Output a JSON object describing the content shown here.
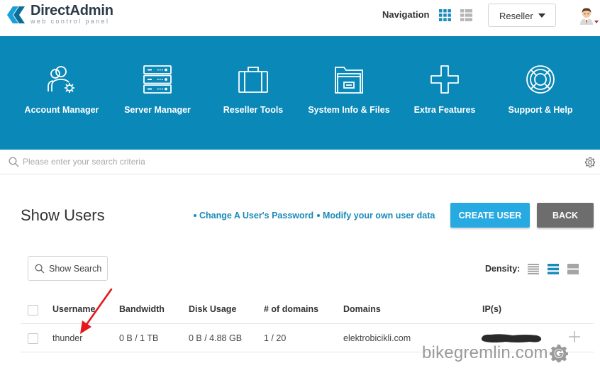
{
  "app": {
    "logo_title": "DirectAdmin",
    "logo_subtitle": "web control panel",
    "accent_color": "#0a88b8",
    "button_color": "#27aae1"
  },
  "header": {
    "navigation_label": "Navigation",
    "view_modes": [
      "grid-view-icon",
      "list-view-icon"
    ],
    "role_selector": {
      "selected": "Reseller"
    },
    "avatar": "user-avatar"
  },
  "banner_menu": [
    {
      "label": "Account Manager",
      "icon": "users-gear-icon"
    },
    {
      "label": "Server Manager",
      "icon": "server-icon"
    },
    {
      "label": "Reseller Tools",
      "icon": "briefcase-icon"
    },
    {
      "label": "System Info & Files",
      "icon": "folder-icon"
    },
    {
      "label": "Extra Features",
      "icon": "plus-icon"
    },
    {
      "label": "Support & Help",
      "icon": "lifebuoy-icon"
    }
  ],
  "search": {
    "placeholder": "Please enter your search criteria",
    "value": ""
  },
  "page": {
    "title": "Show Users",
    "links": [
      "Change A User's Password",
      "Modify your own user data"
    ],
    "create_button": "CREATE USER",
    "back_button": "BACK"
  },
  "table_tools": {
    "show_search": "Show Search",
    "density_label": "Density:",
    "density_options": [
      "compact",
      "normal",
      "comfortable"
    ],
    "density_selected": "normal"
  },
  "table": {
    "columns": [
      "Username",
      "Bandwidth",
      "Disk Usage",
      "# of domains",
      "Domains",
      "IP(s)"
    ],
    "rows": [
      {
        "username": "thunder",
        "bandwidth": "0 B / 1 TB",
        "disk_usage": "0 B / 4.88 GB",
        "domains_count": "1 / 20",
        "domains": "elektrobicikli.com",
        "ip": "redacted"
      }
    ]
  },
  "watermark": {
    "text": "bikegremlin.com"
  }
}
